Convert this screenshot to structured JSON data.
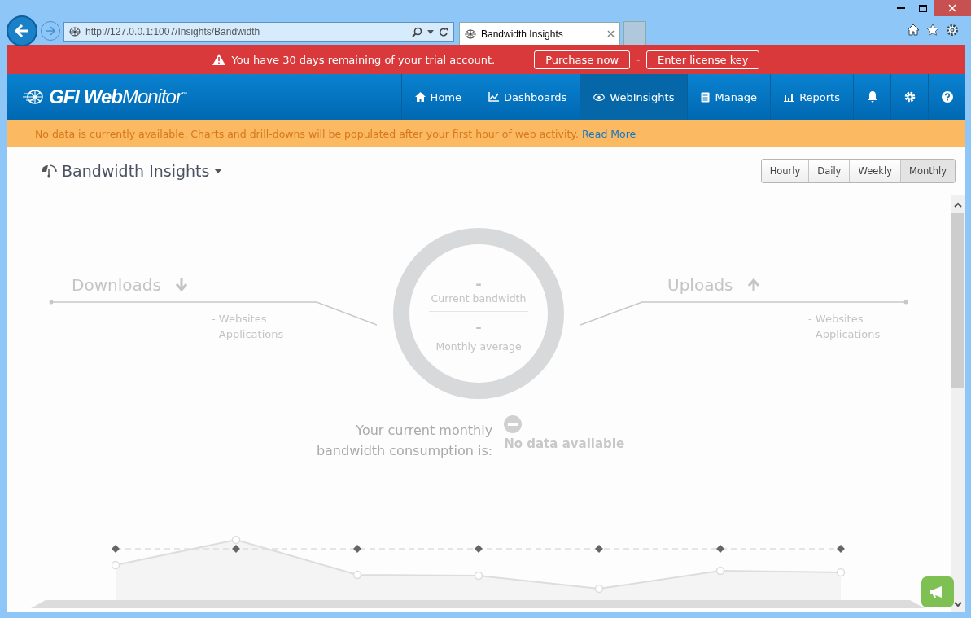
{
  "browser": {
    "address": "http://127.0.0.1:1007/Insights/Bandwidth",
    "tab": "Bandwidth Insights"
  },
  "trial_bar": {
    "message": "You have 30 days remaining of your trial account.",
    "buttons": [
      "Purchase now",
      "Enter license key"
    ],
    "separator": "-"
  },
  "header": {
    "logo": "**GFI Web**Monitor$^{™}$",
    "nav": [
      {
        "label": "Home",
        "selected": false
      },
      {
        "label": "Dashboards",
        "selected": false
      },
      {
        "label": "WebInsights",
        "selected": true
      },
      {
        "label": "Manage",
        "selected": false
      },
      {
        "label": "Reports",
        "selected": false
      }
    ]
  },
  "notice": {
    "text": "No data is currently available. Charts and drill-downs will be populated after your first hour of web activity.",
    "link": "Read More"
  },
  "page": {
    "title": "Bandwidth Insights",
    "periods": [
      {
        "label": "Hourly",
        "selected": false
      },
      {
        "label": "Daily",
        "selected": false
      },
      {
        "label": "Weekly",
        "selected": false
      },
      {
        "label": "Monthly",
        "selected": true
      }
    ]
  },
  "downloads": {
    "title": "Downloads",
    "items": [
      "- Websites",
      "- Applications"
    ]
  },
  "uploads": {
    "title": "Uploads",
    "items": [
      "- Websites",
      "- Applications"
    ]
  },
  "gauge": {
    "current_value": "-",
    "current_label": "Current bandwidth",
    "average_value": "-",
    "average_label": "Monthly average"
  },
  "consumption": {
    "lines": [
      "Your current monthly",
      "bandwidth consumption is:"
    ],
    "status": "No data available"
  }
}
